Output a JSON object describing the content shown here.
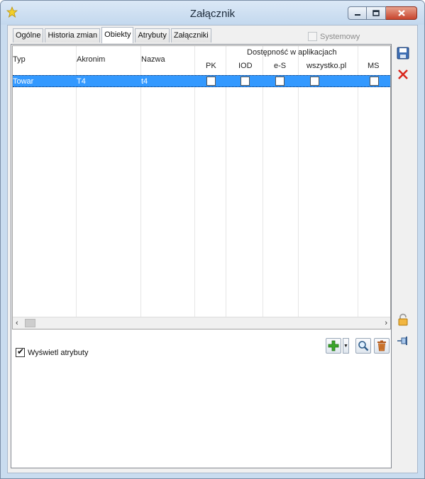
{
  "window": {
    "title": "Załącznik",
    "app_icon": "star-icon",
    "controls": {
      "minimize": "minimize-icon",
      "maximize": "maximize-icon",
      "close": "close-icon"
    }
  },
  "tabs": [
    {
      "label": "Ogólne",
      "active": false
    },
    {
      "label": "Historia zmian",
      "active": false
    },
    {
      "label": "Obiekty",
      "active": true
    },
    {
      "label": "Atrybuty",
      "active": false
    },
    {
      "label": "Załączniki",
      "active": false
    }
  ],
  "systemowy": {
    "label": "Systemowy",
    "checked": false,
    "enabled": false
  },
  "grid": {
    "columns": {
      "typ": "Typ",
      "akronim": "Akronim",
      "nazwa": "Nazwa"
    },
    "group_header": "Dostępność w aplikacjach",
    "apps": [
      "PK",
      "IOD",
      "e-S",
      "wszystko.pl",
      "MS"
    ],
    "rows": [
      {
        "typ": "Towar",
        "akronim": "T4",
        "nazwa": "t4",
        "apps": [
          false,
          false,
          false,
          false,
          false
        ],
        "selected": true
      }
    ],
    "scroll_left": "‹",
    "scroll_right": "›"
  },
  "options": {
    "show_attributes_label": "Wyświetl atrybuty",
    "show_attributes_checked": true
  },
  "toolbar": {
    "add": "add-icon",
    "add_menu": "dropdown-arrow-icon",
    "search": "magnifier-icon",
    "delete": "trash-icon"
  },
  "side": {
    "save": "save-icon",
    "cancel": "cancel-x-icon",
    "lock": "padlock-icon",
    "pin": "pin-icon"
  },
  "colors": {
    "selection": "#3399ff",
    "accent_green": "#2e8b1c",
    "cancel_red": "#d9261c",
    "titlebar": "#c9dcef"
  }
}
